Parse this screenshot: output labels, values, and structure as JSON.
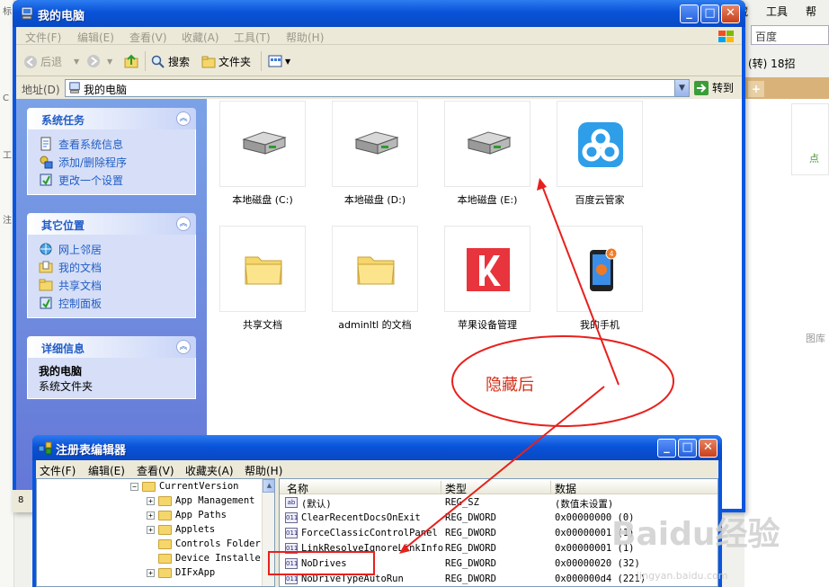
{
  "background_browser": {
    "menu": [
      "藏",
      "工具",
      "帮"
    ],
    "search_text": "百度",
    "bar2_text": "(转) 18招",
    "card_text": "点",
    "side_text": "图库",
    "left_strip": [
      "标",
      "C",
      "工",
      "注",
      "8"
    ]
  },
  "my_computer": {
    "title": "我的电脑",
    "menu": [
      "文件(F)",
      "编辑(E)",
      "查看(V)",
      "收藏(A)",
      "工具(T)",
      "帮助(H)"
    ],
    "toolbar": {
      "back": "后退",
      "search": "搜索",
      "folders": "文件夹"
    },
    "address": {
      "label": "地址(D)",
      "value": "我的电脑",
      "go": "转到"
    },
    "tasks": {
      "system_tasks": {
        "title": "系统任务",
        "links": [
          "查看系统信息",
          "添加/删除程序",
          "更改一个设置"
        ]
      },
      "other_places": {
        "title": "其它位置",
        "links": [
          "网上邻居",
          "我的文档",
          "共享文档",
          "控制面板"
        ]
      },
      "details": {
        "title": "详细信息",
        "name": "我的电脑",
        "type": "系统文件夹"
      }
    },
    "items": [
      {
        "label": "本地磁盘 (C:)",
        "icon": "hard-drive-icon"
      },
      {
        "label": "本地磁盘 (D:)",
        "icon": "hard-drive-icon"
      },
      {
        "label": "本地磁盘 (E:)",
        "icon": "hard-drive-icon"
      },
      {
        "label": "百度云管家",
        "icon": "baidu-cloud-icon"
      },
      {
        "label": "共享文档",
        "icon": "folder-icon"
      },
      {
        "label": "adminltl 的文档",
        "icon": "folder-icon"
      },
      {
        "label": "苹果设备管理",
        "icon": "apple-manager-icon"
      },
      {
        "label": "我的手机",
        "icon": "phone-icon"
      }
    ]
  },
  "annotation": {
    "ellipse_text": "隐藏后",
    "color": "#e8201c"
  },
  "regedit": {
    "title": "注册表编辑器",
    "menu": [
      "文件(F)",
      "编辑(E)",
      "查看(V)",
      "收藏夹(A)",
      "帮助(H)"
    ],
    "tree": [
      {
        "label": "CurrentVersion",
        "expander": "−"
      },
      {
        "label": "App Management",
        "expander": "+"
      },
      {
        "label": "App Paths",
        "expander": "+"
      },
      {
        "label": "Applets",
        "expander": "+"
      },
      {
        "label": "Controls Folder",
        "expander": ""
      },
      {
        "label": "Device Installe",
        "expander": ""
      },
      {
        "label": "DIFxApp",
        "expander": "+"
      }
    ],
    "columns": [
      "名称",
      "类型",
      "数据"
    ],
    "rows": [
      {
        "name": "(默认)",
        "type": "REG_SZ",
        "data": "(数值未设置)",
        "icon": "ab"
      },
      {
        "name": "ClearRecentDocsOnExit",
        "type": "REG_DWORD",
        "data": "0x00000000 (0)",
        "icon": "011"
      },
      {
        "name": "ForceClassicControlPanel",
        "type": "REG_DWORD",
        "data": "0x00000001 (1)",
        "icon": "011"
      },
      {
        "name": "LinkResolveIgnoreLinkInfo",
        "type": "REG_DWORD",
        "data": "0x00000001 (1)",
        "icon": "011"
      },
      {
        "name": "NoDrives",
        "type": "REG_DWORD",
        "data": "0x00000020 (32)",
        "icon": "011"
      },
      {
        "name": "NoDriveTypeAutoRun",
        "type": "REG_DWORD",
        "data": "0x000000d4 (221)",
        "icon": "011"
      }
    ]
  },
  "watermark": {
    "brand": "Baidu经验",
    "url": "jingyan.baidu.com"
  }
}
